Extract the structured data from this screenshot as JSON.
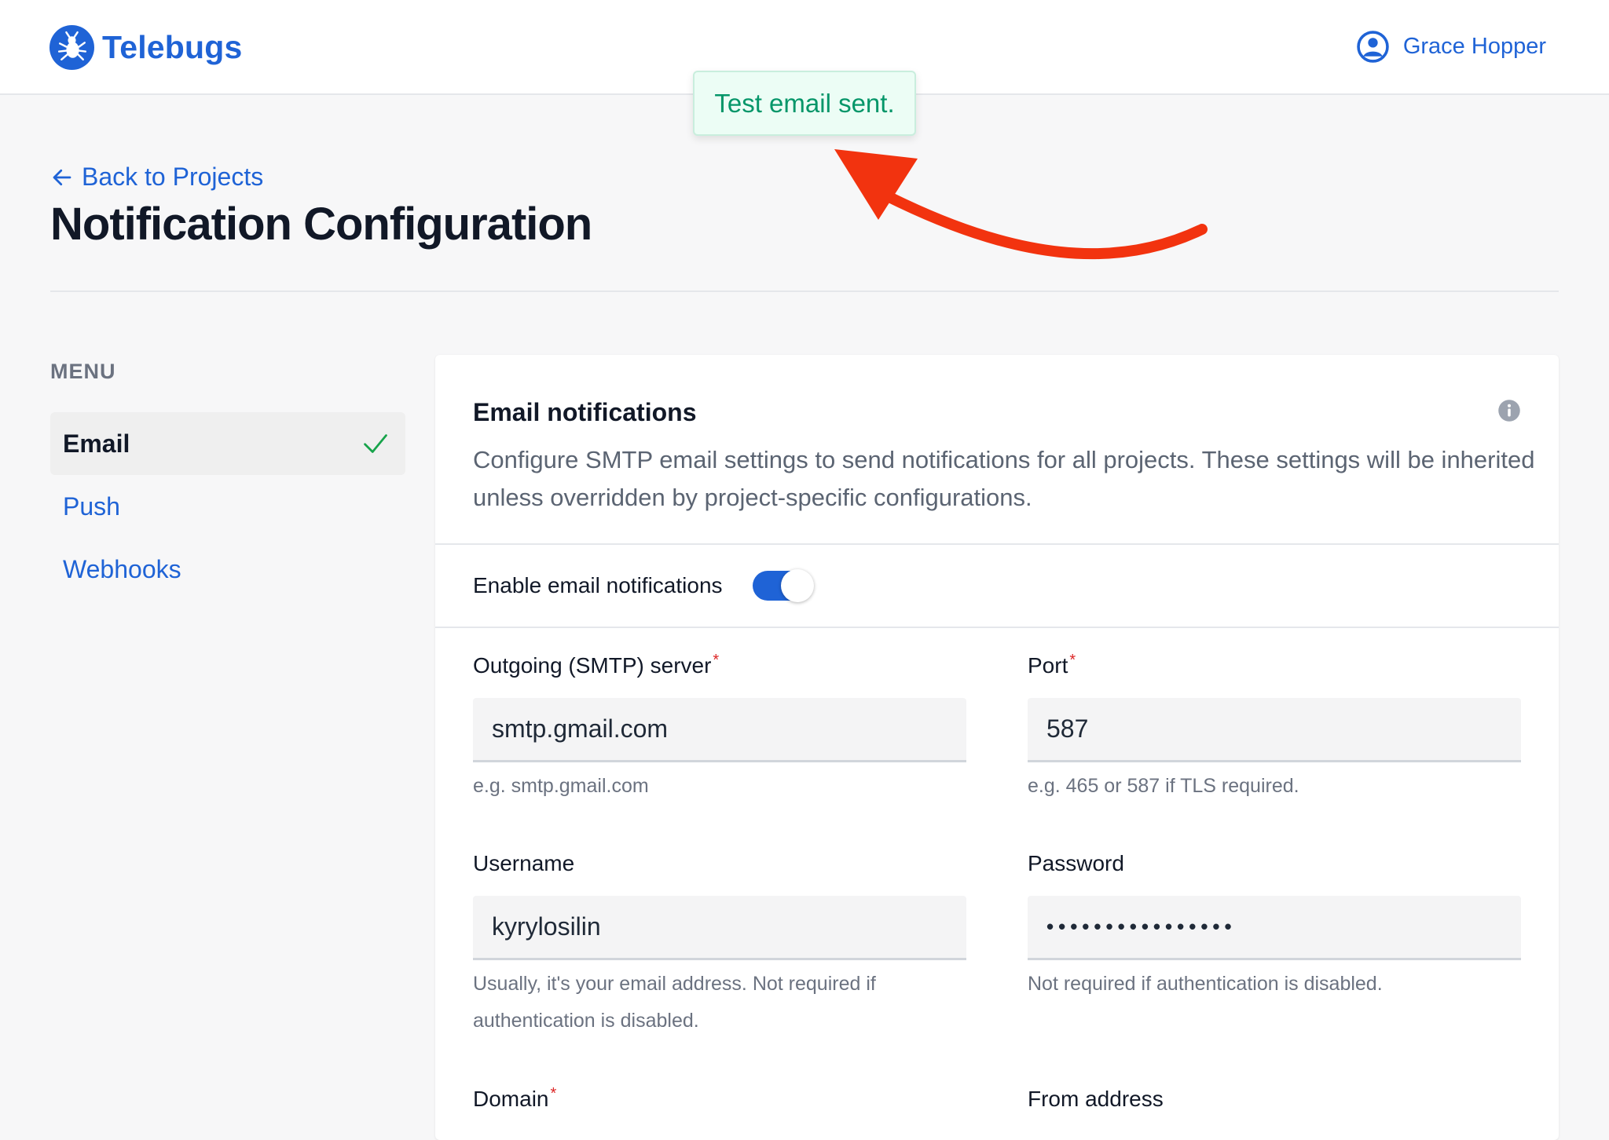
{
  "app": {
    "name": "Telebugs",
    "user": "Grace Hopper",
    "accent_color": "#1f63d6"
  },
  "toast": {
    "message": "Test email sent.",
    "color": "#059669"
  },
  "header": {
    "back_link": "Back to Projects",
    "title": "Notification Configuration"
  },
  "sidebar": {
    "heading": "MENU",
    "items": [
      {
        "label": "Email",
        "active": true,
        "icon": "check-icon"
      },
      {
        "label": "Push",
        "active": false
      },
      {
        "label": "Webhooks",
        "active": false
      }
    ]
  },
  "card": {
    "title": "Email notifications",
    "description": "Configure SMTP email settings to send notifications for all projects. These settings will be inherited unless overridden by project-specific configurations.",
    "toggle": {
      "label": "Enable email notifications",
      "enabled": true
    },
    "fields": {
      "smtp_server": {
        "label": "Outgoing (SMTP) server",
        "required": "*",
        "value": "smtp.gmail.com",
        "hint": "e.g. smtp.gmail.com"
      },
      "port": {
        "label": "Port",
        "required": "*",
        "value": "587",
        "hint": "e.g. 465 or 587 if TLS required."
      },
      "username": {
        "label": "Username",
        "value": "kyrylosilin",
        "hint": "Usually, it's your email address. Not required if authentication is disabled."
      },
      "password": {
        "label": "Password",
        "value": "••••••••••••••••",
        "hint": "Not required if authentication is disabled."
      },
      "domain": {
        "label": "Domain",
        "required": "*"
      },
      "from_address": {
        "label": "From address"
      }
    }
  }
}
